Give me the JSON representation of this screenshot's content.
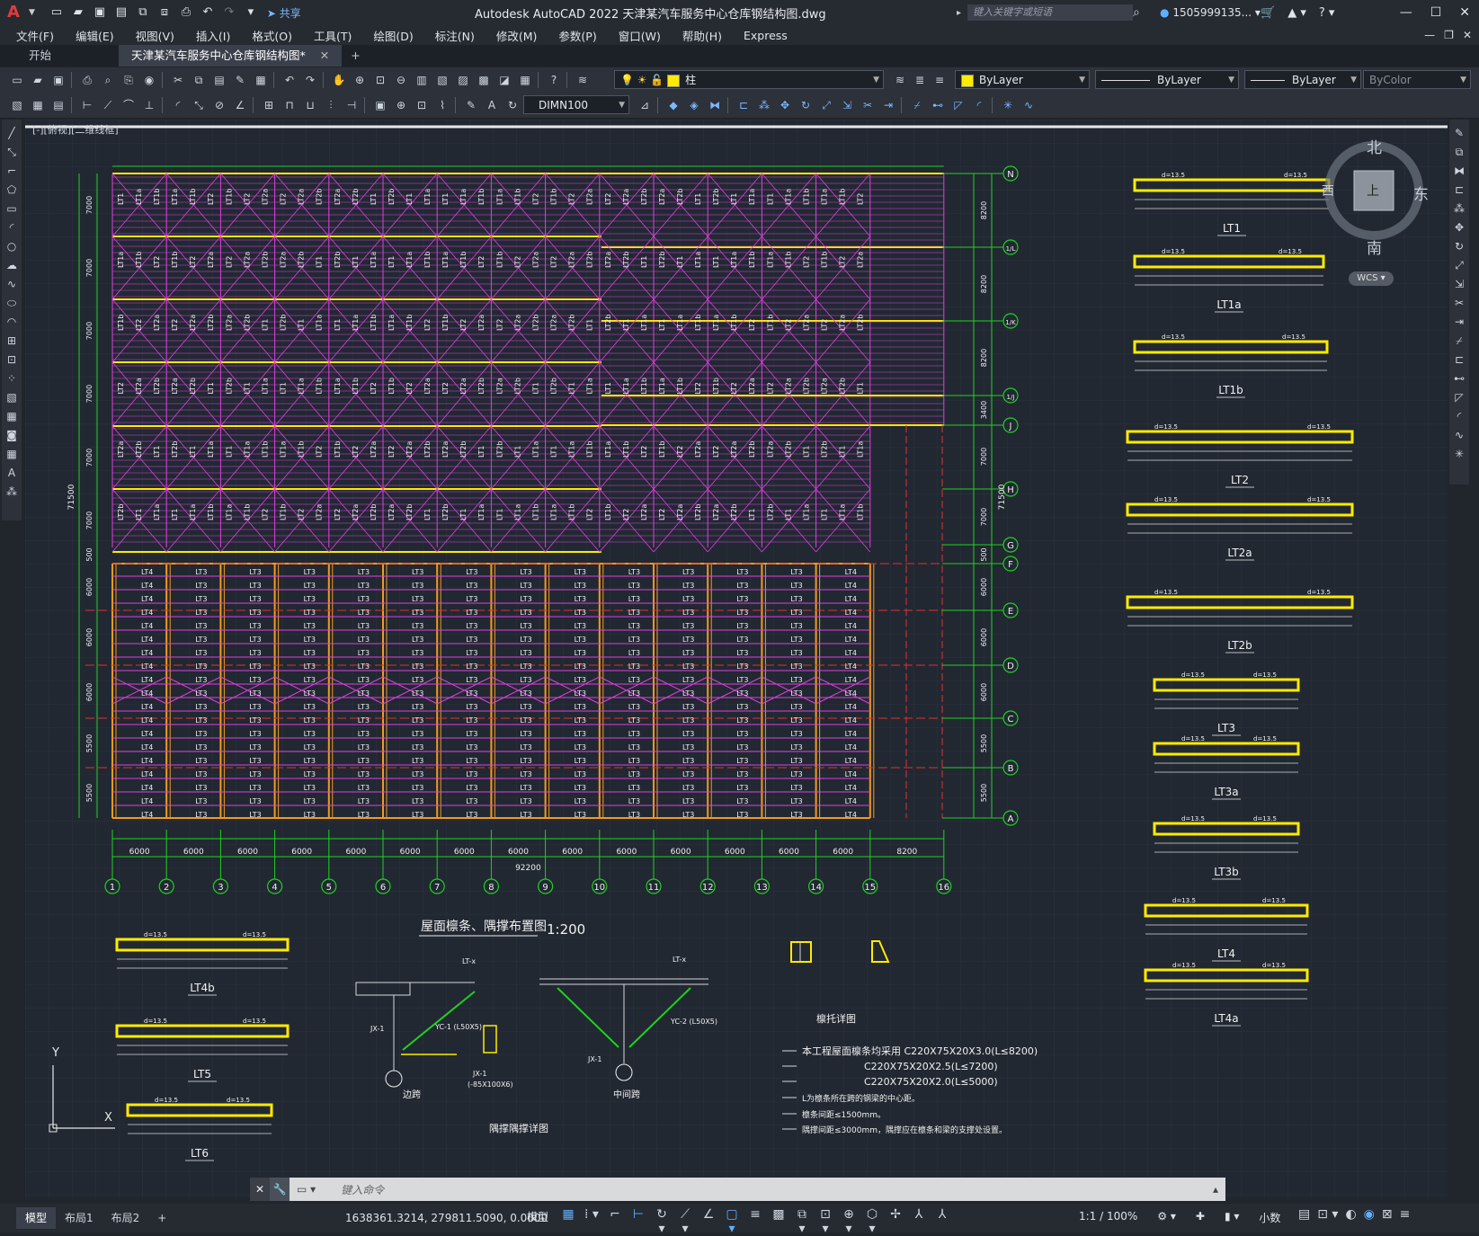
{
  "app": {
    "title": "Autodesk AutoCAD 2022    天津某汽车服务中心仓库钢结构图.dwg",
    "logo": "A",
    "share": "共享",
    "search_placeholder": "键入关键字或短语",
    "user": "1505999135...",
    "help": "?"
  },
  "quick_access": [
    "new-icon",
    "open-icon",
    "save-icon",
    "saveas-icon",
    "web-open-icon",
    "web-save-icon",
    "plot-icon",
    "undo-icon",
    "redo-icon",
    "more-icon"
  ],
  "menu": [
    "文件(F)",
    "编辑(E)",
    "视图(V)",
    "插入(I)",
    "格式(O)",
    "工具(T)",
    "绘图(D)",
    "标注(N)",
    "修改(M)",
    "参数(P)",
    "窗口(W)",
    "帮助(H)",
    "Express"
  ],
  "tabs": {
    "start": "开始",
    "active": "天津某汽车服务中心仓库钢结构图*",
    "plus": "+"
  },
  "toolbar": {
    "layer": "柱",
    "color": "ByLayer",
    "linetype": "ByLayer",
    "lineweight": "ByLayer",
    "plotstyle": "ByColor",
    "dimstyle": "DIMN100"
  },
  "viewcube": {
    "n": "北",
    "s": "南",
    "e": "东",
    "w": "西",
    "top": "上",
    "wcs": "WCS"
  },
  "view_label": "[-][俯视][二维线框]",
  "drawing": {
    "grid_rows": [
      "N",
      "1/L",
      "1/K",
      "1/J",
      "J",
      "H",
      "G",
      "F",
      "E",
      "D",
      "C",
      "B",
      "A"
    ],
    "grid_cols": [
      "1",
      "2",
      "3",
      "4",
      "5",
      "6",
      "7",
      "8",
      "9",
      "10",
      "11",
      "12",
      "13",
      "14",
      "15",
      "16"
    ],
    "span_dims": [
      "6000",
      "6000",
      "6000",
      "6000",
      "6000",
      "6000",
      "6000",
      "6000",
      "6000",
      "6000",
      "6000",
      "6000",
      "6000",
      "6000",
      "8200"
    ],
    "total_width": "92200",
    "left_dims": [
      "7000",
      "7000",
      "7000",
      "7000",
      "7000",
      "7000",
      "500",
      "6000",
      "6000",
      "6000",
      "5500",
      "5500"
    ],
    "right_dims": [
      "8200",
      "8200",
      "8200",
      "3400",
      "7000",
      "7000",
      "500",
      "6000",
      "6000",
      "6000",
      "5500",
      "5500"
    ],
    "total_height": "71500",
    "title": "屋面檩条、隅撑布置图",
    "scale": "1:200",
    "purlin_labels": [
      "LT1",
      "LT1a",
      "LT1b",
      "LT2",
      "LT2a",
      "LT2b",
      "LT3",
      "LT3a",
      "LT3b",
      "LT4",
      "LT4a"
    ],
    "bottom_purlins": [
      "LT4b",
      "LT5",
      "LT6"
    ],
    "detail_bracket": "檩托详图",
    "detail_edge": "边跨",
    "detail_mid": "中间跨",
    "detail_title": "隅撑隅撑详图",
    "detail_jx1": "JX-1",
    "detail_jx1_spec": "(-85X100X6)",
    "detail_yc1": "YC-1 (L50X5)",
    "detail_yc2": "YC-2 (L50X5)",
    "detail_lt": "LT-x",
    "notes": [
      "本工程屋面檩条均采用  C220X75X20X3.0(L≤8200)",
      "C220X75X20X2.5(L≤7200)",
      "C220X75X20X2.0(L≤5000)",
      "L为檩条所在跨的钢梁的中心距。",
      "檩条间距≤1500mm。",
      "隅撑间距≤3000mm，隅撑应在檩条和梁的支撑处设置。"
    ],
    "ucs_y": "Y",
    "ucs_x": "X",
    "dim_text": "d=13.5"
  },
  "command": {
    "placeholder": "键入命令"
  },
  "status": {
    "layouts": [
      "模型",
      "布局1",
      "布局2"
    ],
    "add": "+",
    "coords": "1638361.3214, 279811.5090, 0.0000",
    "model": "模型",
    "scale": "1:1 / 100%",
    "units": "小数"
  },
  "colors": {
    "magenta": "#e040e0",
    "yellow": "#ffeb00",
    "green": "#1ed21e",
    "orange": "#f29a1e",
    "red": "#e53030",
    "accent": "#5fb0ff"
  }
}
